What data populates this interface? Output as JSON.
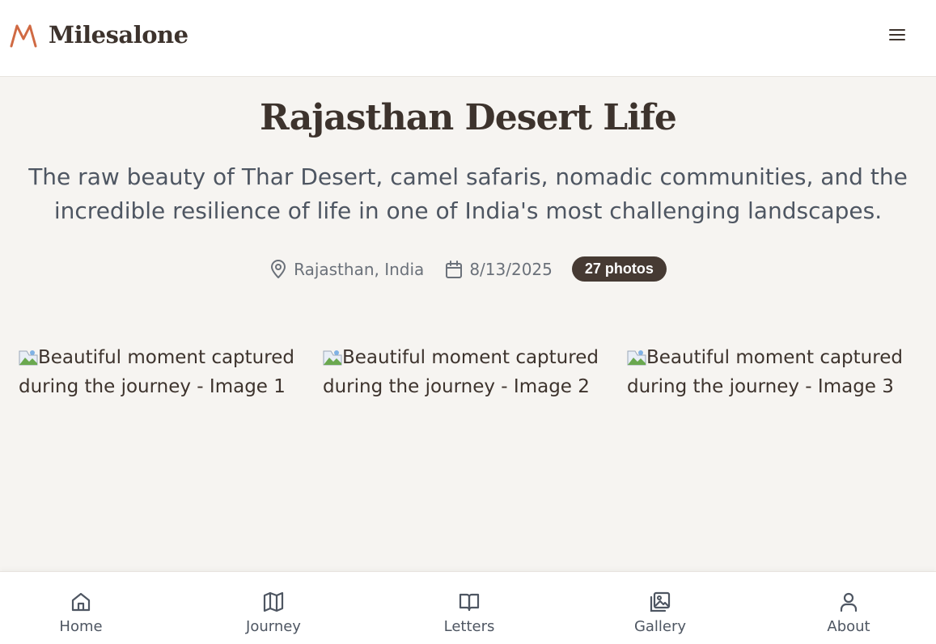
{
  "header": {
    "brand": "Milesalone",
    "logo_icon": "mountain-logo-icon",
    "menu_icon": "hamburger-menu-icon",
    "accent_color": "#d06a43"
  },
  "page": {
    "title": "Rajasthan Desert Life",
    "subtitle": "The raw beauty of Thar Desert, camel safaris, nomadic communities, and the incredible resilience of life in one of India's most challenging landscapes.",
    "location": "Rajasthan, India",
    "date": "8/13/2025",
    "photo_count": "27 photos"
  },
  "gallery": {
    "images": [
      {
        "alt": "Beautiful moment captured during the journey - Image 1"
      },
      {
        "alt": "Beautiful moment captured during the journey - Image 2"
      },
      {
        "alt": "Beautiful moment captured during the journey - Image 3"
      }
    ]
  },
  "bottom_nav": {
    "items": [
      {
        "label": "Home",
        "icon": "home-icon"
      },
      {
        "label": "Journey",
        "icon": "map-icon"
      },
      {
        "label": "Letters",
        "icon": "book-open-icon"
      },
      {
        "label": "Gallery",
        "icon": "images-icon"
      },
      {
        "label": "About",
        "icon": "user-icon"
      }
    ]
  }
}
